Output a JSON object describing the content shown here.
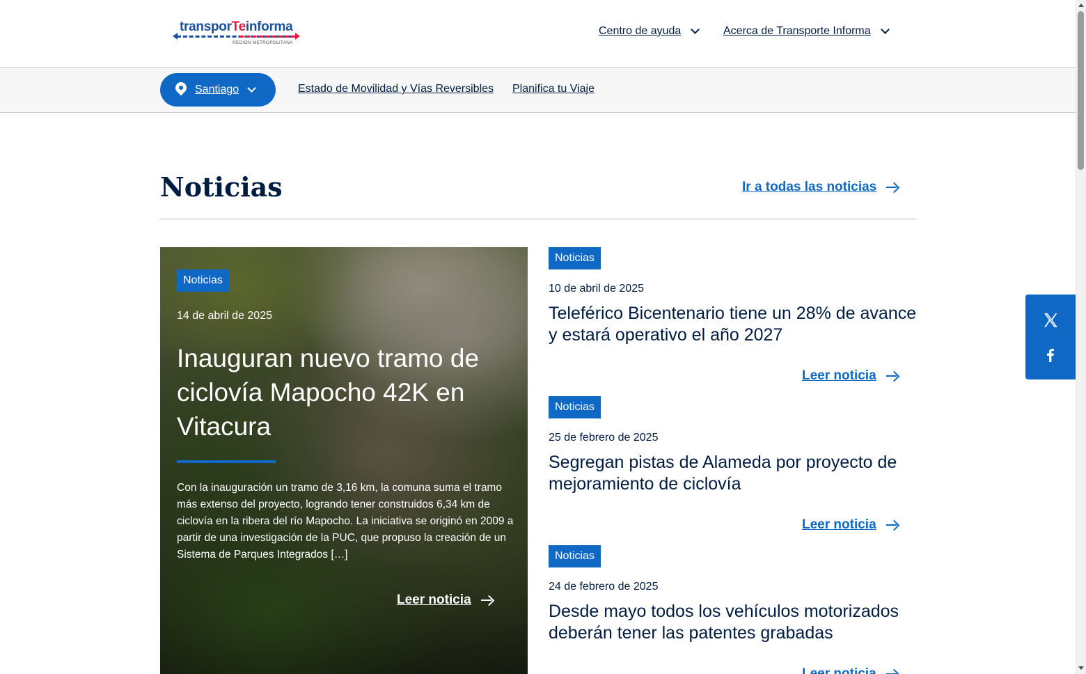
{
  "brand": {
    "logo_main_1": "transpor",
    "logo_main_2": "Te",
    "logo_main_3": "informa",
    "logo_sub": "REGIÓN METROPOLITANA"
  },
  "header": {
    "nav": [
      {
        "label": "Centro de ayuda"
      },
      {
        "label": "Acerca de Transporte Informa"
      }
    ]
  },
  "subnav": {
    "city": "Santiago",
    "links": [
      {
        "label": "Estado de Movilidad y Vías Reversibles"
      },
      {
        "label": "Planifica tu Viaje"
      }
    ]
  },
  "section": {
    "title": "Noticias",
    "all_link": "Ir a todas las noticias"
  },
  "featured": {
    "category": "Noticias",
    "date": "14 de abril de 2025",
    "title": "Inauguran nuevo tramo de ciclovía Mapocho 42K en Vitacura",
    "excerpt": "Con la inauguración un tramo de 3,16 km, la comuna suma el tramo más extenso del proyecto, logrando tener construidos 6,34 km de ciclovía en la ribera del río Mapocho.   La iniciativa se originó en 2009 a partir de una investigación de la PUC, que propuso la creación de un Sistema de Parques Integrados […]",
    "read_label": "Leer noticia"
  },
  "news": [
    {
      "category": "Noticias",
      "date": "10 de abril de 2025",
      "title": "Teleférico Bicentenario tiene un 28% de avance y estará operativo el año 2027",
      "read_label": "Leer noticia"
    },
    {
      "category": "Noticias",
      "date": "25 de febrero de 2025",
      "title": "Segregan pistas de Alameda por proyecto de mejoramiento de ciclovía",
      "read_label": "Leer noticia"
    },
    {
      "category": "Noticias",
      "date": "24 de febrero de 2025",
      "title": "Desde mayo todos los vehículos motorizados deberán tener las patentes grabadas",
      "read_label": "Leer noticia"
    }
  ],
  "share": {
    "icons": [
      "x-icon",
      "facebook-icon"
    ]
  },
  "colors": {
    "primary": "#0f69c4",
    "text": "#001c41",
    "brand_red": "#e5173f",
    "brand_blue": "#1b4fa0"
  }
}
